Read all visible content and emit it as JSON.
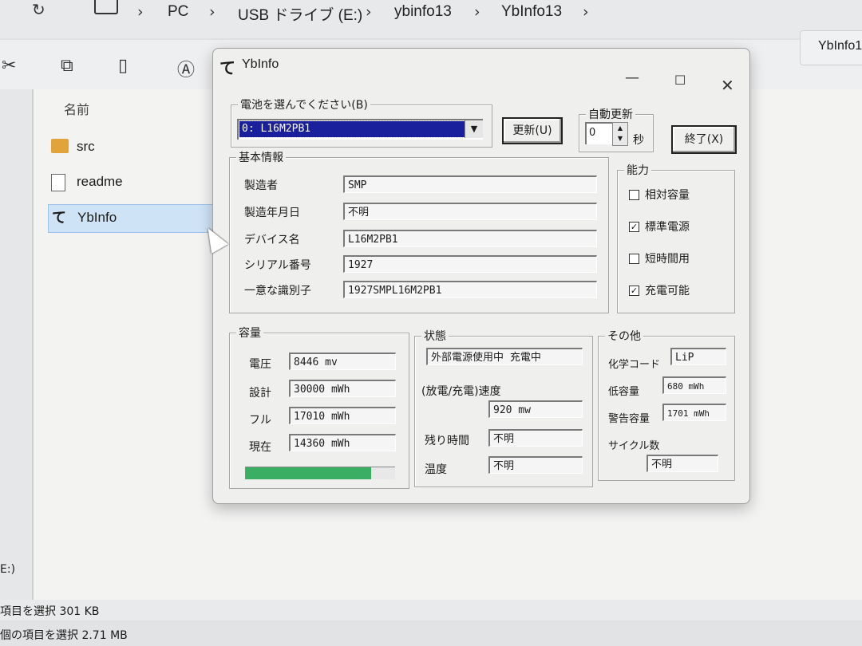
{
  "explorer": {
    "breadcrumb": [
      "PC",
      "USB ドライブ (E:)",
      "ybinfo13",
      "YbInfo13"
    ],
    "tab_title": "YbInfo1",
    "column_header": "名前",
    "files": [
      {
        "name": "src",
        "icon": "folder-icon",
        "selected": false
      },
      {
        "name": "readme",
        "icon": "document-icon",
        "selected": false
      },
      {
        "name": "YbInfo",
        "icon": "ybinfo-app-icon",
        "selected": true
      }
    ],
    "drive_label": "E:)",
    "status1": "項目を選択  301 KB",
    "status2": "個の項目を選択  2.71 MB"
  },
  "window": {
    "title": "YbInfo",
    "icon_glyph": "て"
  },
  "battery_select": {
    "label": "電池を選んでください(B)",
    "value": "0: L16M2PB1"
  },
  "buttons": {
    "refresh": "更新(U)",
    "exit": "終了(X)"
  },
  "auto_update": {
    "label": "自動更新",
    "value": "0",
    "unit": "秒"
  },
  "basic": {
    "label": "基本情報",
    "rows": [
      {
        "label": "製造者",
        "value": "SMP"
      },
      {
        "label": "製造年月日",
        "value": "不明"
      },
      {
        "label": "デバイス名",
        "value": "L16M2PB1"
      },
      {
        "label": "シリアル番号",
        "value": "1927"
      },
      {
        "label": "一意な識別子",
        "value": "1927SMPL16M2PB1"
      }
    ]
  },
  "capability": {
    "label": "能力",
    "items": [
      {
        "label": "相対容量",
        "checked": false
      },
      {
        "label": "標準電源",
        "checked": true
      },
      {
        "label": "短時間用",
        "checked": false
      },
      {
        "label": "充電可能",
        "checked": true
      }
    ]
  },
  "capacity": {
    "label": "容量",
    "rows": [
      {
        "label": "電圧",
        "value": "8446 mv"
      },
      {
        "label": "設計",
        "value": "30000 mWh"
      },
      {
        "label": "フル",
        "value": "17010 mWh"
      },
      {
        "label": "現在",
        "value": "14360 mWh"
      }
    ],
    "fill_fraction": 0.84
  },
  "status": {
    "label": "状態",
    "state": "外部電源使用中 充電中",
    "rate_label": "(放電/充電)速度",
    "rate": "920 mw",
    "remaining_label": "残り時間",
    "remaining": "不明",
    "temp_label": "温度",
    "temp": "不明"
  },
  "other": {
    "label": "その他",
    "chem_label": "化学コード",
    "chem": "LiP",
    "low_label": "低容量",
    "low": "680 mWh",
    "warn_label": "警告容量",
    "warn": "1701 mWh",
    "cycle_label": "サイクル数",
    "cycle": "不明"
  }
}
